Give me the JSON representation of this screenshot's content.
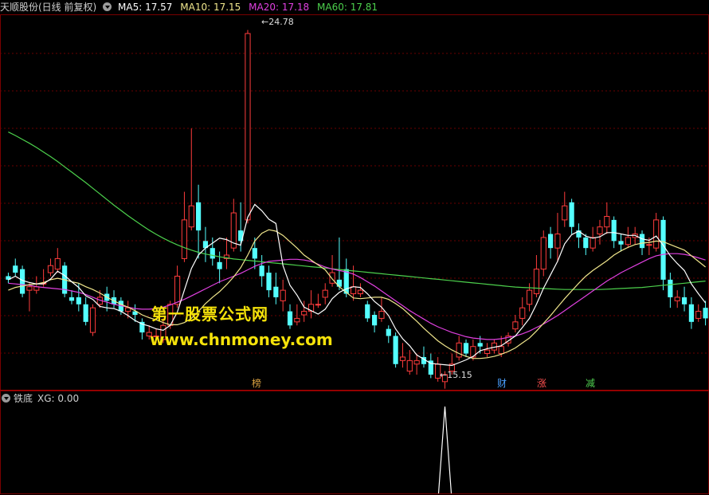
{
  "header": {
    "stock_name": "天顺股份(日线 前复权)",
    "ma5": "MA5: 17.57",
    "ma10": "MA10: 17.15",
    "ma20": "MA20: 17.18",
    "ma60": "MA60: 17.81",
    "colors": {
      "ma5": "#ffffff",
      "ma10": "#f0e68c",
      "ma20": "#e040e0",
      "ma60": "#4cd04c"
    }
  },
  "annotations": {
    "high": "24.78",
    "low": "15.15"
  },
  "watermark": {
    "line1": "第一股票公式网",
    "line2": "www.chnmoney.com"
  },
  "event_tags": [
    {
      "label": "榜",
      "color": "#d8a040"
    },
    {
      "label": "财",
      "color": "#4aa0ff"
    },
    {
      "label": "涨",
      "color": "#ff5050"
    },
    {
      "label": "减",
      "color": "#50d050"
    }
  ],
  "indicator": {
    "name": "铁底",
    "value_label": "XG: 0.00"
  },
  "chart_data": {
    "type": "candlestick",
    "up_color": "#ff3c3c",
    "down_color": "#54ffff",
    "y_range": [
      15.0,
      25.2
    ],
    "candles": [
      [
        17.8,
        17.7,
        17.9,
        17.6
      ],
      [
        18.1,
        17.9,
        18.3,
        17.8
      ],
      [
        18.0,
        17.3,
        18.1,
        17.2
      ],
      [
        17.4,
        17.5,
        17.6,
        16.8
      ],
      [
        17.4,
        17.5,
        17.8,
        17.3
      ],
      [
        17.6,
        17.6,
        18.0,
        17.5
      ],
      [
        17.9,
        18.1,
        18.3,
        17.8
      ],
      [
        18.0,
        18.3,
        18.6,
        17.9
      ],
      [
        18.1,
        17.3,
        18.2,
        17.2
      ],
      [
        17.2,
        17.1,
        17.4,
        17.0
      ],
      [
        17.2,
        17.0,
        17.6,
        16.8
      ],
      [
        17.0,
        16.5,
        17.2,
        16.4
      ],
      [
        16.2,
        16.9,
        17.0,
        16.1
      ],
      [
        17.0,
        17.2,
        17.4,
        16.9
      ],
      [
        17.3,
        17.1,
        17.5,
        16.8
      ],
      [
        17.2,
        17.0,
        17.4,
        16.9
      ],
      [
        17.1,
        16.8,
        17.2,
        16.7
      ],
      [
        16.8,
        16.9,
        17.1,
        16.6
      ],
      [
        16.8,
        16.7,
        17.0,
        16.5
      ],
      [
        16.5,
        16.2,
        16.6,
        16.0
      ],
      [
        16.1,
        16.2,
        16.4,
        16.0
      ],
      [
        16.1,
        16.1,
        16.3,
        15.9
      ],
      [
        16.0,
        16.4,
        16.6,
        15.9
      ],
      [
        16.4,
        17.0,
        17.1,
        16.3
      ],
      [
        17.0,
        17.8,
        18.1,
        16.9
      ],
      [
        18.3,
        19.4,
        20.2,
        18.2
      ],
      [
        19.2,
        19.8,
        22.0,
        19.1
      ],
      [
        19.9,
        19.1,
        20.4,
        18.3
      ],
      [
        18.8,
        18.6,
        19.2,
        18.2
      ],
      [
        18.6,
        18.3,
        18.9,
        18.1
      ],
      [
        18.2,
        18.0,
        18.5,
        17.6
      ],
      [
        18.3,
        18.4,
        18.9,
        18.0
      ],
      [
        18.6,
        19.6,
        20.0,
        18.5
      ],
      [
        19.1,
        18.8,
        19.9,
        18.5
      ],
      [
        19.4,
        24.7,
        24.8,
        19.3
      ],
      [
        18.6,
        18.3,
        18.9,
        18.0
      ],
      [
        18.1,
        17.8,
        18.4,
        17.5
      ],
      [
        17.9,
        17.4,
        18.1,
        17.2
      ],
      [
        17.5,
        17.2,
        17.9,
        17.0
      ],
      [
        17.1,
        17.4,
        17.7,
        16.8
      ],
      [
        16.8,
        16.4,
        17.0,
        16.3
      ],
      [
        16.5,
        16.6,
        17.0,
        16.4
      ],
      [
        16.7,
        16.8,
        17.1,
        16.5
      ],
      [
        16.8,
        17.0,
        17.4,
        16.6
      ],
      [
        17.0,
        17.0,
        17.3,
        16.9
      ],
      [
        17.2,
        17.4,
        17.6,
        17.0
      ],
      [
        17.6,
        17.9,
        18.4,
        17.5
      ],
      [
        17.7,
        17.5,
        18.9,
        17.4
      ],
      [
        18.0,
        17.3,
        18.3,
        17.2
      ],
      [
        17.3,
        17.5,
        18.1,
        17.1
      ],
      [
        17.3,
        17.4,
        17.6,
        17.2
      ],
      [
        17.0,
        16.6,
        17.1,
        16.5
      ],
      [
        16.7,
        16.4,
        16.8,
        16.2
      ],
      [
        16.6,
        16.8,
        17.2,
        16.5
      ],
      [
        16.3,
        16.1,
        16.4,
        15.9
      ],
      [
        16.1,
        15.3,
        16.2,
        15.2
      ],
      [
        15.4,
        15.5,
        15.9,
        15.2
      ],
      [
        15.1,
        15.4,
        15.7,
        15.0
      ],
      [
        15.3,
        15.4,
        15.6,
        15.0
      ],
      [
        15.5,
        15.3,
        15.8,
        15.2
      ],
      [
        15.4,
        15.0,
        15.6,
        14.9
      ],
      [
        14.9,
        15.3,
        15.5,
        14.8
      ],
      [
        14.8,
        15.0,
        15.1,
        14.6
      ],
      [
        15.1,
        15.3,
        15.6,
        15.0
      ],
      [
        15.5,
        15.9,
        16.1,
        15.4
      ],
      [
        15.9,
        15.6,
        16.0,
        15.5
      ],
      [
        15.5,
        15.8,
        16.0,
        15.4
      ],
      [
        15.9,
        15.8,
        16.1,
        15.6
      ],
      [
        15.6,
        15.7,
        15.9,
        15.5
      ],
      [
        15.7,
        15.9,
        16.0,
        15.6
      ],
      [
        15.6,
        15.8,
        16.1,
        15.5
      ],
      [
        15.9,
        16.1,
        16.2,
        15.8
      ],
      [
        16.3,
        16.5,
        16.7,
        16.2
      ],
      [
        16.6,
        16.9,
        17.2,
        16.4
      ],
      [
        17.0,
        17.4,
        17.6,
        16.8
      ],
      [
        17.3,
        18.0,
        18.4,
        17.2
      ],
      [
        18.0,
        18.9,
        19.1,
        17.8
      ],
      [
        19.0,
        18.6,
        19.2,
        18.3
      ],
      [
        18.6,
        19.0,
        19.6,
        18.2
      ],
      [
        19.4,
        19.8,
        20.2,
        19.2
      ],
      [
        19.9,
        19.2,
        20.0,
        19.0
      ],
      [
        19.1,
        18.9,
        19.3,
        18.6
      ],
      [
        18.9,
        18.6,
        19.0,
        18.4
      ],
      [
        18.6,
        18.9,
        19.2,
        18.5
      ],
      [
        19.0,
        19.2,
        19.4,
        18.7
      ],
      [
        19.2,
        19.5,
        19.9,
        19.0
      ],
      [
        19.4,
        18.8,
        19.5,
        18.6
      ],
      [
        18.8,
        18.7,
        19.0,
        18.5
      ],
      [
        18.7,
        18.9,
        19.2,
        18.6
      ],
      [
        18.9,
        19.0,
        19.2,
        18.7
      ],
      [
        19.0,
        18.6,
        19.1,
        18.4
      ],
      [
        18.7,
        18.7,
        18.9,
        18.4
      ],
      [
        18.6,
        19.4,
        19.6,
        18.5
      ],
      [
        19.4,
        17.7,
        19.5,
        17.4
      ],
      [
        17.7,
        17.2,
        17.9,
        16.9
      ],
      [
        17.1,
        17.2,
        17.4,
        16.9
      ],
      [
        17.2,
        17.0,
        17.5,
        16.8
      ],
      [
        17.0,
        16.5,
        17.2,
        16.3
      ],
      [
        16.6,
        16.8,
        17.0,
        16.5
      ],
      [
        16.9,
        16.6,
        17.1,
        16.4
      ]
    ],
    "ma5": [
      17.7,
      17.8,
      17.68,
      17.62,
      17.58,
      17.58,
      17.72,
      17.94,
      17.82,
      17.64,
      17.48,
      17.24,
      17.14,
      16.94,
      16.9,
      16.88,
      16.8,
      16.68,
      16.54,
      16.44,
      16.38,
      16.3,
      16.26,
      16.4,
      16.78,
      17.4,
      18.02,
      18.4,
      18.6,
      18.74,
      18.88,
      18.84,
      18.74,
      18.68,
      19.48,
      19.84,
      19.66,
      19.42,
      19.3,
      18.1,
      17.54,
      17.26,
      16.92,
      16.82,
      16.72,
      16.86,
      17.16,
      17.34,
      17.44,
      17.5,
      17.48,
      17.3,
      17.08,
      16.92,
      16.68,
      16.3,
      16.02,
      15.82,
      15.56,
      15.44,
      15.32,
      15.3,
      15.28,
      15.26,
      15.34,
      15.42,
      15.52,
      15.68,
      15.74,
      15.78,
      15.82,
      15.96,
      16.1,
      16.34,
      16.6,
      17.0,
      17.46,
      17.84,
      18.22,
      18.72,
      18.98,
      19.08,
      18.94,
      18.88,
      18.92,
      19.04,
      19.04,
      19.0,
      18.96,
      18.96,
      18.86,
      18.82,
      18.94,
      18.68,
      18.38,
      18.16,
      17.96,
      17.58,
      17.3,
      17.04
    ],
    "ma10": [
      17.4,
      17.48,
      17.52,
      17.56,
      17.58,
      17.62,
      17.7,
      17.74,
      17.7,
      17.64,
      17.6,
      17.5,
      17.42,
      17.32,
      17.2,
      17.1,
      17.0,
      16.92,
      16.82,
      16.7,
      16.62,
      16.56,
      16.48,
      16.42,
      16.42,
      16.48,
      16.6,
      16.8,
      17.02,
      17.2,
      17.36,
      17.56,
      17.78,
      18.04,
      18.4,
      18.8,
      19.02,
      19.12,
      19.08,
      18.96,
      18.78,
      18.6,
      18.4,
      18.26,
      18.12,
      17.98,
      17.72,
      17.5,
      17.34,
      17.18,
      17.16,
      17.18,
      17.2,
      17.2,
      17.14,
      17.02,
      16.88,
      16.7,
      16.52,
      16.32,
      16.14,
      15.96,
      15.82,
      15.7,
      15.6,
      15.52,
      15.46,
      15.46,
      15.48,
      15.52,
      15.58,
      15.66,
      15.76,
      15.9,
      16.04,
      16.24,
      16.46,
      16.68,
      16.92,
      17.16,
      17.38,
      17.6,
      17.8,
      17.96,
      18.1,
      18.24,
      18.4,
      18.52,
      18.62,
      18.7,
      18.74,
      18.76,
      18.8,
      18.78,
      18.7,
      18.62,
      18.54,
      18.38,
      18.22,
      18.06
    ],
    "ma20": [
      17.6,
      17.58,
      17.56,
      17.54,
      17.5,
      17.48,
      17.46,
      17.44,
      17.42,
      17.38,
      17.34,
      17.28,
      17.2,
      17.12,
      17.06,
      17.0,
      16.96,
      16.92,
      16.88,
      16.86,
      16.86,
      16.88,
      16.92,
      16.98,
      17.06,
      17.14,
      17.24,
      17.34,
      17.44,
      17.54,
      17.64,
      17.72,
      17.8,
      17.88,
      17.98,
      18.08,
      18.16,
      18.22,
      18.24,
      18.26,
      18.28,
      18.28,
      18.26,
      18.22,
      18.14,
      18.06,
      18.0,
      17.96,
      17.92,
      17.86,
      17.76,
      17.64,
      17.52,
      17.38,
      17.24,
      17.1,
      16.96,
      16.82,
      16.7,
      16.58,
      16.46,
      16.36,
      16.28,
      16.2,
      16.14,
      16.08,
      16.04,
      16.02,
      16.0,
      16.0,
      16.02,
      16.06,
      16.1,
      16.16,
      16.24,
      16.34,
      16.44,
      16.56,
      16.68,
      16.82,
      16.96,
      17.1,
      17.24,
      17.38,
      17.52,
      17.66,
      17.78,
      17.9,
      18.0,
      18.1,
      18.2,
      18.3,
      18.38,
      18.42,
      18.44,
      18.44,
      18.42,
      18.38,
      18.32,
      18.26
    ],
    "ma60": [
      21.9,
      21.8,
      21.69,
      21.58,
      21.46,
      21.33,
      21.2,
      21.06,
      20.91,
      20.76,
      20.61,
      20.46,
      20.3,
      20.14,
      19.98,
      19.82,
      19.67,
      19.52,
      19.38,
      19.24,
      19.11,
      18.99,
      18.88,
      18.78,
      18.69,
      18.61,
      18.54,
      18.48,
      18.43,
      18.39,
      18.35,
      18.32,
      18.29,
      18.27,
      18.25,
      18.23,
      18.21,
      18.19,
      18.17,
      18.15,
      18.13,
      18.11,
      18.09,
      18.07,
      18.05,
      18.03,
      18.01,
      17.99,
      17.97,
      17.95,
      17.93,
      17.91,
      17.89,
      17.87,
      17.85,
      17.83,
      17.81,
      17.79,
      17.77,
      17.75,
      17.73,
      17.71,
      17.69,
      17.67,
      17.65,
      17.63,
      17.61,
      17.59,
      17.57,
      17.55,
      17.53,
      17.51,
      17.49,
      17.48,
      17.47,
      17.46,
      17.45,
      17.44,
      17.43,
      17.42,
      17.42,
      17.42,
      17.42,
      17.42,
      17.42,
      17.43,
      17.44,
      17.45,
      17.46,
      17.47,
      17.48,
      17.5,
      17.52,
      17.54,
      17.56,
      17.58,
      17.6,
      17.62,
      17.64,
      17.66
    ],
    "indicator_xg": {
      "signal_index": 62,
      "value": 1,
      "baseline": 0
    }
  }
}
